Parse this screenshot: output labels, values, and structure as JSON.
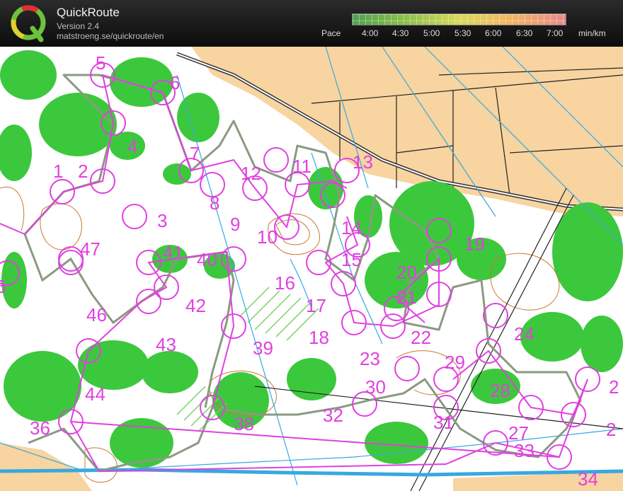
{
  "header": {
    "title": "QuickRoute",
    "version": "Version 2.4",
    "url": "matstroeng.se/quickroute/en",
    "logo_letter": "Q"
  },
  "pace_legend": {
    "label": "Pace",
    "ticks": [
      "4:00",
      "4:30",
      "5:00",
      "5:30",
      "6:00",
      "6:30",
      "7:00"
    ],
    "unit": "min/km"
  },
  "colors": {
    "vegetation": "#3cc83c",
    "open_land": "#f7d4a0",
    "course": "#e040e0",
    "contour": "#c87830",
    "water": "#38a8e0",
    "route": "#8a9a80"
  },
  "controls": [
    {
      "label": "1"
    },
    {
      "label": "2"
    },
    {
      "label": "3"
    },
    {
      "label": "4"
    },
    {
      "label": "5"
    },
    {
      "label": "6"
    },
    {
      "label": "7"
    },
    {
      "label": "8"
    },
    {
      "label": "9"
    },
    {
      "label": "10"
    },
    {
      "label": "11"
    },
    {
      "label": "12"
    },
    {
      "label": "13"
    },
    {
      "label": "14"
    },
    {
      "label": "15"
    },
    {
      "label": "16"
    },
    {
      "label": "17"
    },
    {
      "label": "18"
    },
    {
      "label": "19"
    },
    {
      "label": "20"
    },
    {
      "label": "21"
    },
    {
      "label": "22"
    },
    {
      "label": "23"
    },
    {
      "label": "24"
    },
    {
      "label": "27"
    },
    {
      "label": "28"
    },
    {
      "label": "29"
    },
    {
      "label": "30"
    },
    {
      "label": "31"
    },
    {
      "label": "32"
    },
    {
      "label": "33"
    },
    {
      "label": "34"
    },
    {
      "label": "36"
    },
    {
      "label": "38"
    },
    {
      "label": "39"
    },
    {
      "label": "40"
    },
    {
      "label": "41"
    },
    {
      "label": "42"
    },
    {
      "label": "43"
    },
    {
      "label": "44"
    },
    {
      "label": "46"
    },
    {
      "label": "47"
    },
    {
      "label": "5"
    },
    {
      "label": "2"
    },
    {
      "label": "2"
    }
  ]
}
